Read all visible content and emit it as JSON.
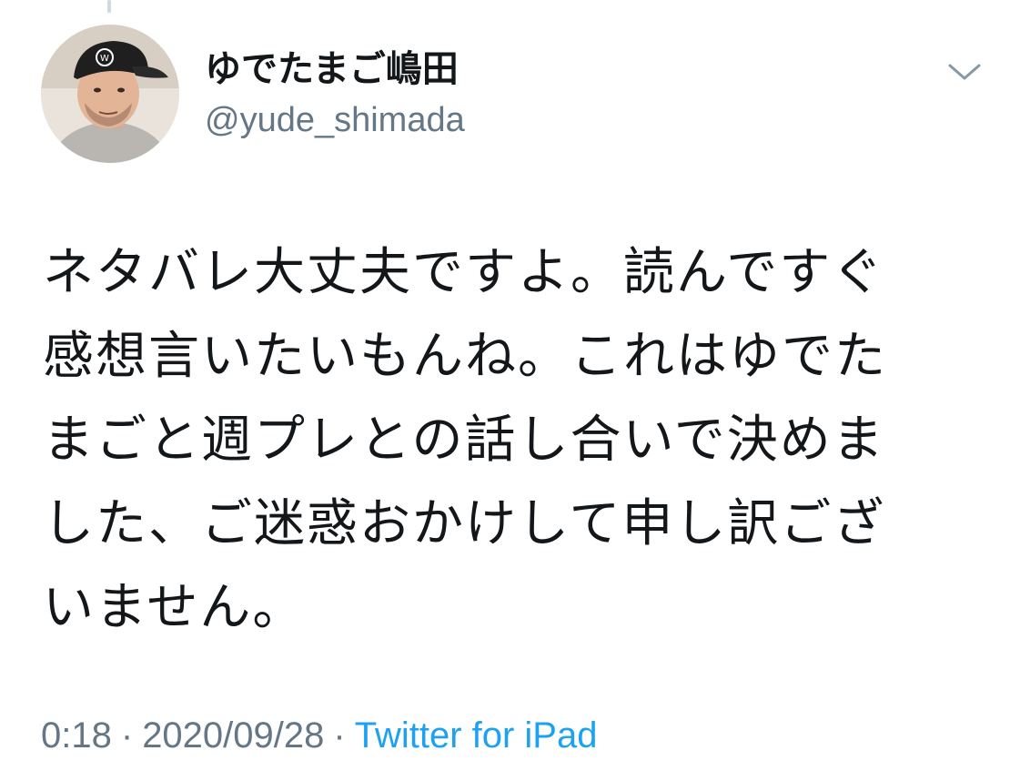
{
  "profile": {
    "display_name": "ゆでたまご嶋田",
    "handle": "@yude_shimada"
  },
  "icons": {
    "avatar": "user-avatar-photo",
    "menu": "chevron-down-icon"
  },
  "tweet": {
    "lines": [
      "ネタバレ大丈夫ですよ。読んですぐ",
      "感想言いたいもんね。これはゆでた",
      "まごと週プレとの話し合いで決めま",
      "した、ご迷惑おかけして申し訳ござ",
      "いません。"
    ]
  },
  "meta": {
    "time": "0:18",
    "separator": "·",
    "date": "2020/09/28",
    "source": "Twitter for iPad"
  },
  "colors": {
    "text": "#14171a",
    "secondary": "#657786",
    "link": "#1da1f2"
  }
}
